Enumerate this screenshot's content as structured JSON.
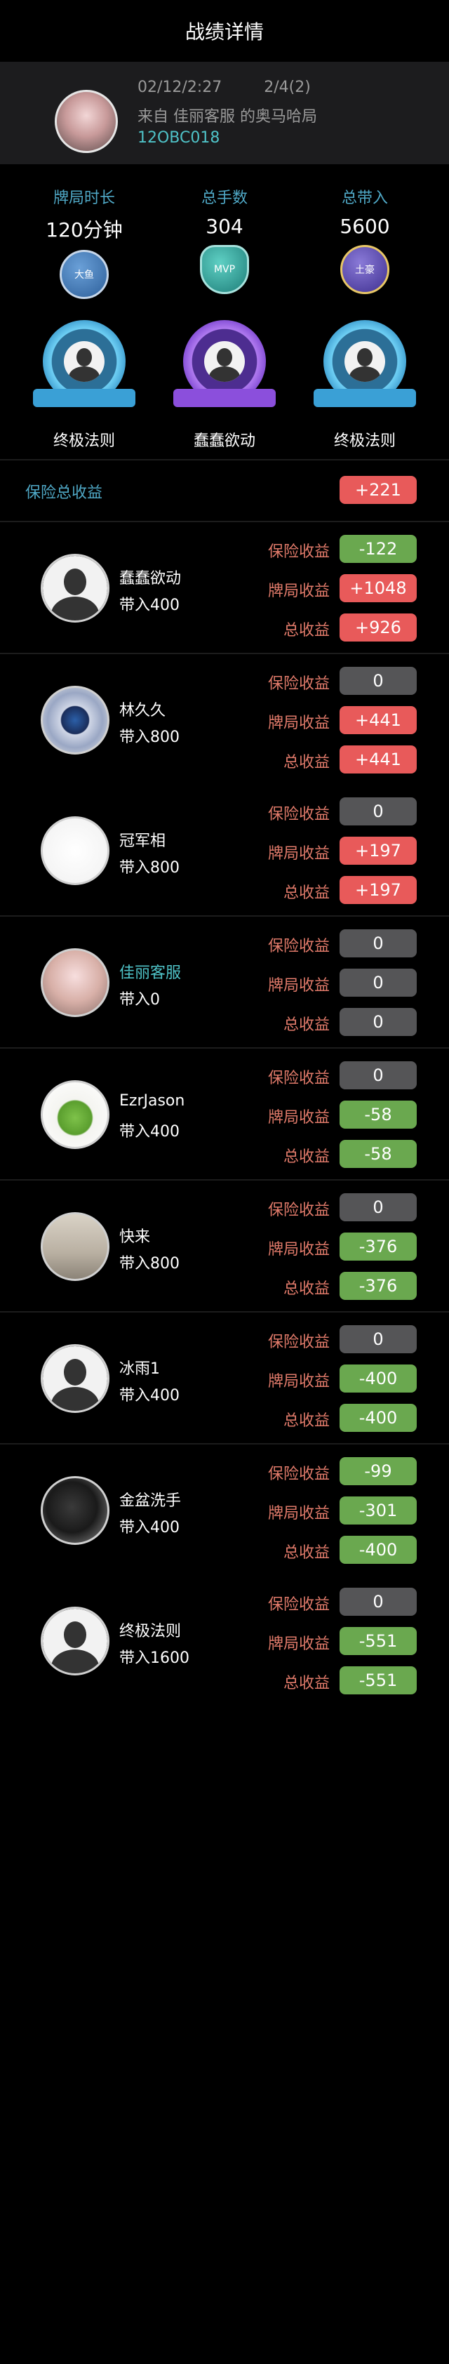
{
  "page_title": "战绩详情",
  "game": {
    "date": "02/12/2:27",
    "hands_info": "2/4(2)",
    "source": "来自 佳丽客服 的奥马哈局",
    "code": "12OBC018"
  },
  "stats": [
    {
      "label": "牌局时长",
      "value": "120分钟",
      "badge": "大鱼",
      "badge_icon": "fish-badge-icon"
    },
    {
      "label": "总手数",
      "value": "304",
      "badge": "MVP",
      "badge_icon": "mvp-badge-icon"
    },
    {
      "label": "总带入",
      "value": "5600",
      "badge": "土豪",
      "badge_icon": "king-badge-icon"
    }
  ],
  "awards": [
    {
      "name": "终极法则",
      "color": "blue"
    },
    {
      "name": "蠢蠢欲动",
      "color": "purple"
    },
    {
      "name": "终极法则",
      "color": "blue"
    }
  ],
  "insurance_total": {
    "label": "保险总收益",
    "value": "+221"
  },
  "row_labels": {
    "insurance": "保险收益",
    "hand": "牌局收益",
    "total": "总收益"
  },
  "players": [
    {
      "name": "蠢蠢欲动",
      "buyin": "带入400",
      "insurance": "-122",
      "hand": "+1048",
      "total": "+926",
      "avatar": "default",
      "name_color": "white"
    },
    {
      "name": "林久久",
      "buyin": "带入800",
      "insurance": "0",
      "hand": "+441",
      "total": "+441",
      "avatar": "eye",
      "name_color": "white"
    },
    {
      "name": "冠军相",
      "buyin": "带入800",
      "insurance": "0",
      "hand": "+197",
      "total": "+197",
      "avatar": "calligraphy",
      "name_color": "white"
    },
    {
      "name": "佳丽客服",
      "buyin": "带入0",
      "insurance": "0",
      "hand": "0",
      "total": "0",
      "avatar": "woman",
      "name_color": "teal"
    },
    {
      "name": "EzrJason",
      "buyin": "带入400",
      "insurance": "0",
      "hand": "-58",
      "total": "-58",
      "avatar": "clover",
      "name_color": "white"
    },
    {
      "name": "快来",
      "buyin": "带入800",
      "insurance": "0",
      "hand": "-376",
      "total": "-376",
      "avatar": "sign",
      "name_color": "white"
    },
    {
      "name": "冰雨1",
      "buyin": "带入400",
      "insurance": "0",
      "hand": "-400",
      "total": "-400",
      "avatar": "default",
      "name_color": "white"
    },
    {
      "name": "金盆洗手",
      "buyin": "带入400",
      "insurance": "-99",
      "hand": "-301",
      "total": "-400",
      "avatar": "dark",
      "name_color": "white"
    },
    {
      "name": "终极法则",
      "buyin": "带入1600",
      "insurance": "0",
      "hand": "-551",
      "total": "-551",
      "avatar": "default",
      "name_color": "white"
    }
  ],
  "colors": {
    "positive": "#e85a5a",
    "negative": "#6aa84f",
    "zero": "#555557",
    "accent": "#4fa8c6"
  }
}
